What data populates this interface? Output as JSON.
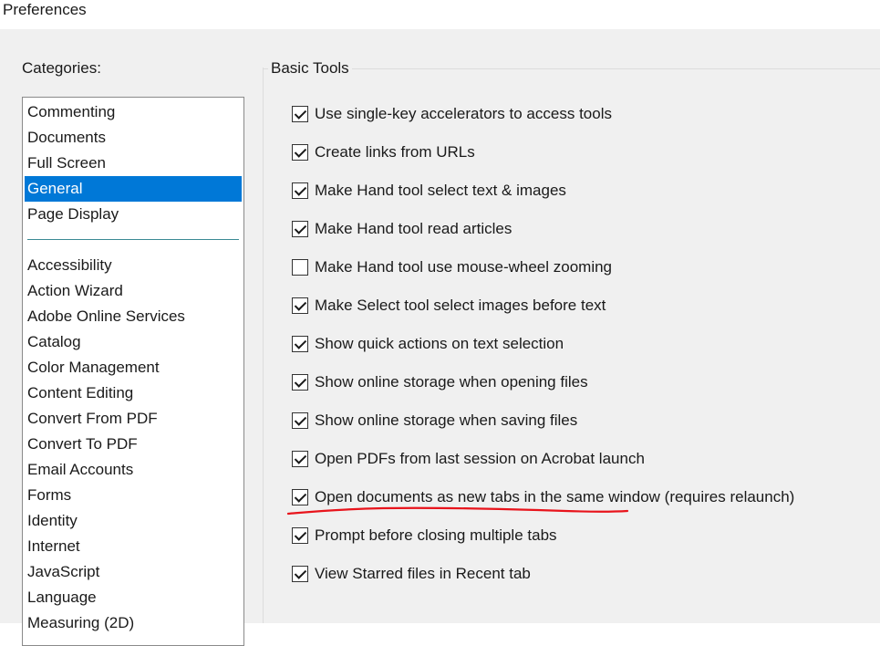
{
  "window": {
    "title": "Preferences"
  },
  "categories": {
    "label": "Categories:",
    "top_items": [
      {
        "label": "Commenting"
      },
      {
        "label": "Documents"
      },
      {
        "label": "Full Screen"
      },
      {
        "label": "General",
        "selected": true
      },
      {
        "label": "Page Display"
      }
    ],
    "items": [
      {
        "label": "Accessibility"
      },
      {
        "label": "Action Wizard"
      },
      {
        "label": "Adobe Online Services"
      },
      {
        "label": "Catalog"
      },
      {
        "label": "Color Management"
      },
      {
        "label": "Content Editing"
      },
      {
        "label": "Convert From PDF"
      },
      {
        "label": "Convert To PDF"
      },
      {
        "label": "Email Accounts"
      },
      {
        "label": "Forms"
      },
      {
        "label": "Identity"
      },
      {
        "label": "Internet"
      },
      {
        "label": "JavaScript"
      },
      {
        "label": "Language"
      },
      {
        "label": "Measuring (2D)"
      }
    ]
  },
  "basic_tools": {
    "label": "Basic Tools",
    "options": [
      {
        "label": "Use single-key accelerators to access tools",
        "checked": true
      },
      {
        "label": "Create links from URLs",
        "checked": true
      },
      {
        "label": "Make Hand tool select text & images",
        "checked": true
      },
      {
        "label": "Make Hand tool read articles",
        "checked": true
      },
      {
        "label": "Make Hand tool use mouse-wheel zooming",
        "checked": false
      },
      {
        "label": "Make Select tool select images before text",
        "checked": true
      },
      {
        "label": "Show quick actions on text selection",
        "checked": true
      },
      {
        "label": "Show online storage when opening files",
        "checked": true
      },
      {
        "label": "Show online storage when saving files",
        "checked": true
      },
      {
        "label": "Open PDFs from last session on Acrobat launch",
        "checked": true
      },
      {
        "label": "Open documents as new tabs in the same window (requires relaunch)",
        "checked": true
      },
      {
        "label": "Prompt before closing multiple tabs",
        "checked": true
      },
      {
        "label": "View Starred files in Recent tab",
        "checked": true
      }
    ]
  },
  "colors": {
    "selection": "#0078d7",
    "annotation": "#e8141c"
  }
}
